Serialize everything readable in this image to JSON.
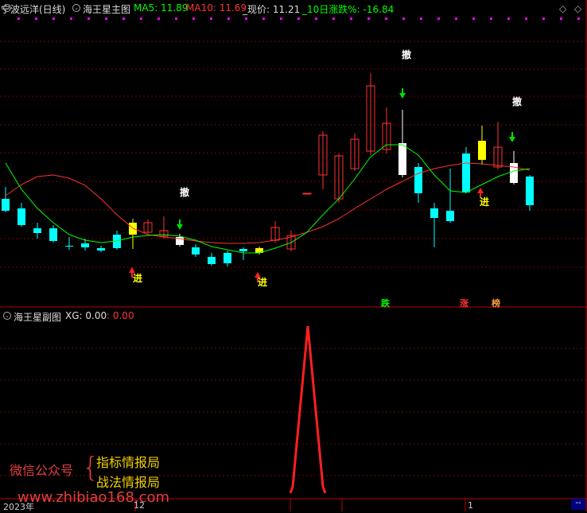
{
  "main": {
    "stock": "宁波远洋(日线)",
    "indicator": "海王星主图",
    "ma5": "MA5: 11.89",
    "ma10": "MA10: 11.69",
    "price": "_现价: 11.21",
    "change": "_10日涨跌%: -16.84",
    "signals": {
      "che": "撤",
      "jin": "进"
    },
    "tags": {
      "die": "跌",
      "zhang": "涨",
      "bang": "榜"
    }
  },
  "sub": {
    "indicator": "海王星副图",
    "xg": "XG: 0.00",
    "val": ": 0.00"
  },
  "axis": {
    "year": "2023年",
    "m12": "12",
    "m1": "1",
    "dashes": "--"
  },
  "watermark": {
    "left": "微信公众号",
    "brace": "{",
    "line1": "指标情报局",
    "line2": "战法情报局",
    "url": "www.zhibiao168.com"
  },
  "colors": {
    "up": "#ff3232",
    "down": "#00ffff",
    "ma5": "#00ff00",
    "ma10": "#ff3232",
    "yellow": "#ffff00",
    "white": "#ffffff",
    "magenta": "#ff00ff"
  }
}
